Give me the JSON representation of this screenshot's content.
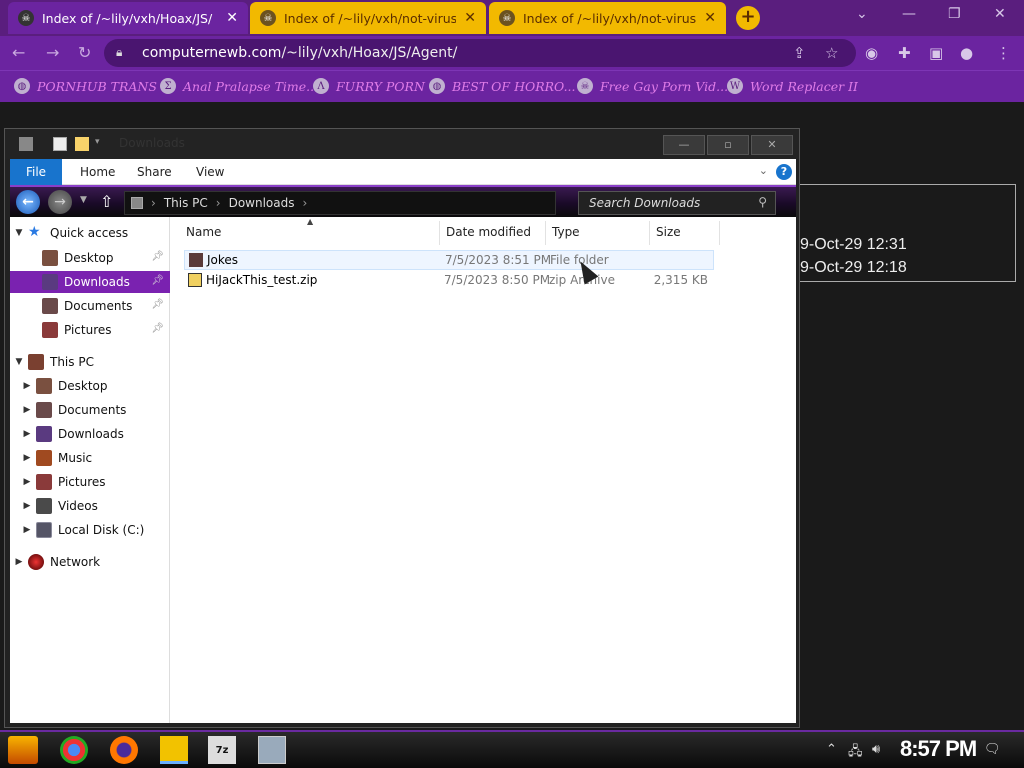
{
  "browser": {
    "tabs": [
      {
        "title": "Index of /~lily/vxh/Hoax/JS/",
        "active": true
      },
      {
        "title": "Index of /~lily/vxh/not-virus",
        "active": false
      },
      {
        "title": "Index of /~lily/vxh/not-virus",
        "active": false
      }
    ],
    "new_tab_label": "+",
    "url_host": "computernewb.com",
    "url_path": "/~lily/vxh/Hoax/JS/Agent/",
    "bookmarks": [
      {
        "label": "PORNHUB TRANS",
        "icon": "globe-icon"
      },
      {
        "label": "Anal Pralapse Time...",
        "icon": "sigma-icon"
      },
      {
        "label": "FURRY PORN",
        "icon": "lambda-icon"
      },
      {
        "label": "BEST OF HORRO...",
        "icon": "globe-icon"
      },
      {
        "label": "Free Gay Porn Vid...",
        "icon": "site-icon"
      },
      {
        "label": "Word Replacer II",
        "icon": "wr-icon"
      }
    ],
    "background_page": {
      "line1": "9-Oct-29 12:31",
      "line2": "9-Oct-29 12:18"
    }
  },
  "explorer": {
    "title": "Downloads",
    "ribbon": {
      "file": "File",
      "tabs": [
        "Home",
        "Share",
        "View"
      ],
      "help": "?"
    },
    "address": {
      "crumbs": [
        "This PC",
        "Downloads"
      ],
      "search_placeholder": "Search Downloads"
    },
    "nav": {
      "quick_access": "Quick access",
      "quick_items": [
        "Desktop",
        "Downloads",
        "Documents",
        "Pictures"
      ],
      "this_pc": "This PC",
      "pc_items": [
        "Desktop",
        "Documents",
        "Downloads",
        "Music",
        "Pictures",
        "Videos",
        "Local Disk (C:)"
      ],
      "network": "Network"
    },
    "columns": {
      "name": "Name",
      "date": "Date modified",
      "type": "Type",
      "size": "Size"
    },
    "files": [
      {
        "name": "Jokes",
        "date": "7/5/2023 8:51 PM",
        "type": "File folder",
        "size": ""
      },
      {
        "name": "HiJackThis_test.zip",
        "date": "7/5/2023 8:50 PM",
        "type": "zip Archive",
        "size": "2,315 KB"
      }
    ]
  },
  "taskbar": {
    "apps": [
      "Start",
      "Chrome",
      "Firefox",
      "File Explorer",
      "7z",
      "Task Manager"
    ],
    "clock": "8:57 PM"
  },
  "colors": {
    "chrome_purple": "#6b24a0",
    "tab_yellow": "#f2b900",
    "selection_purple": "#7a22b0",
    "ribbon_blue": "#1874cd"
  }
}
